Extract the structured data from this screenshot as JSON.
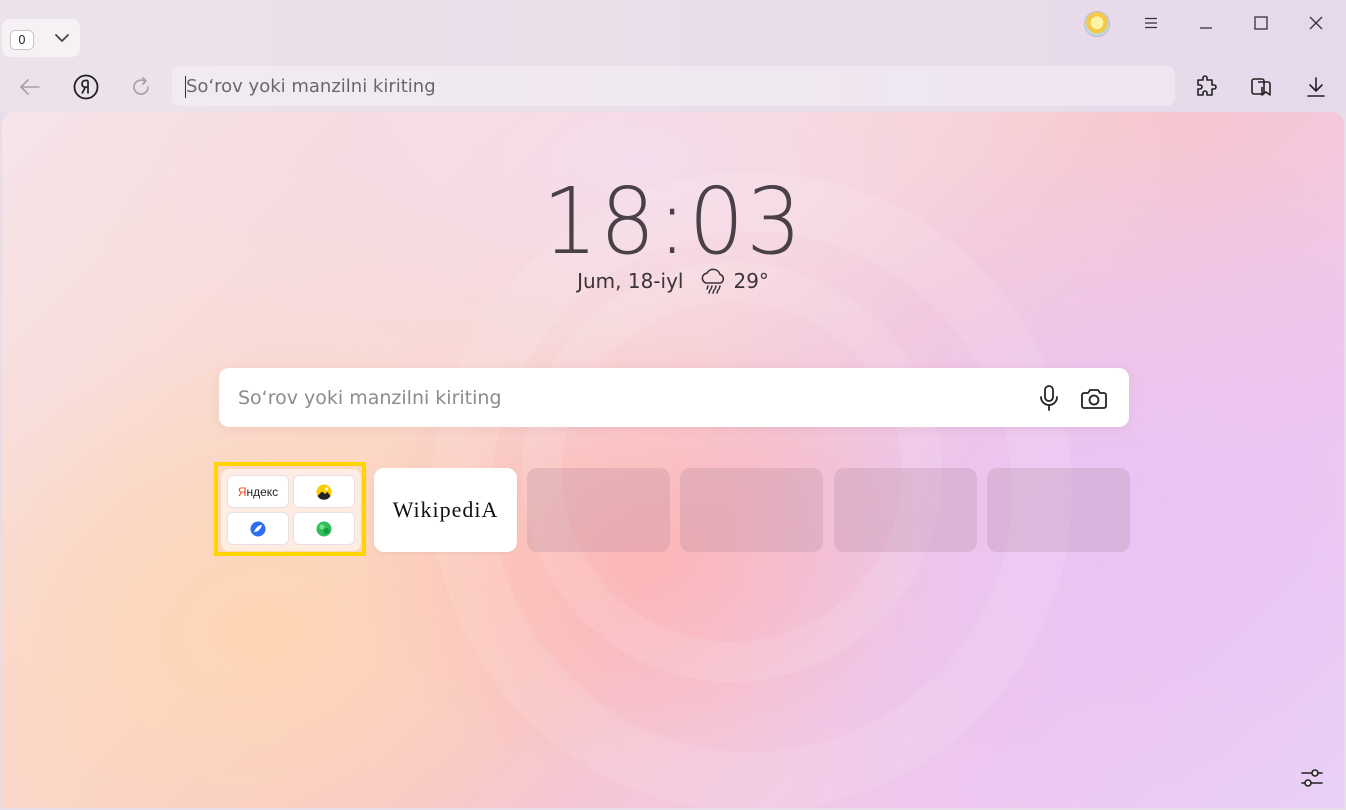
{
  "tabs": {
    "counter": "0"
  },
  "address_bar": {
    "placeholder": "So‘rov yoki manzilni kiriting"
  },
  "clock": {
    "time": "18:03",
    "date": "Jum, 18-iyl",
    "temperature": "29°"
  },
  "search": {
    "placeholder": "So‘rov yoki manzilni kiriting"
  },
  "tiles": {
    "group_yandex_label": "Яндекс",
    "wikipedia_label": "WikipediA"
  },
  "icons": {
    "back": "arrow-left-icon",
    "yandex": "yandex-logo-icon",
    "reload": "reload-icon",
    "extensions": "puzzle-icon",
    "collections": "bookmark-cards-icon",
    "downloads": "download-icon",
    "mic": "microphone-icon",
    "camera": "camera-search-icon",
    "weather": "rain-cloud-icon",
    "settings": "sliders-icon"
  },
  "colors": {
    "highlight": "#ffd400",
    "yandex_red": "#fc3f1d"
  }
}
